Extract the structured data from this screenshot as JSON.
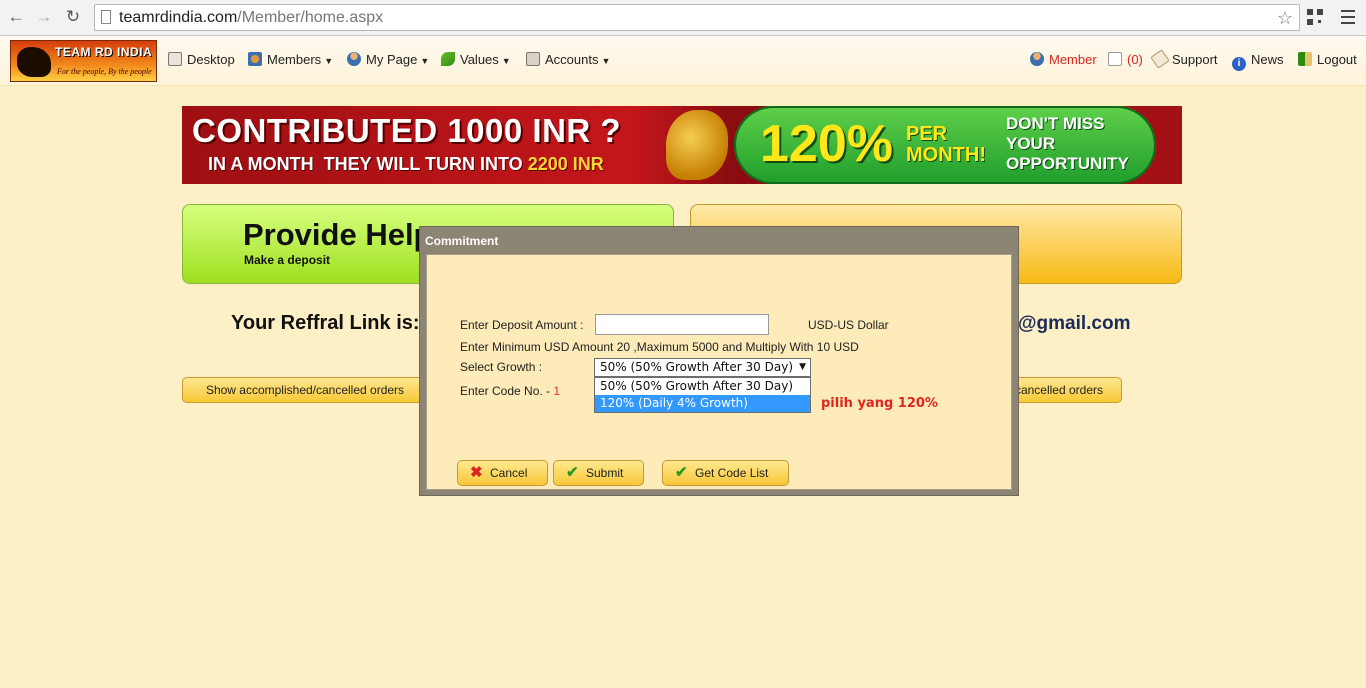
{
  "browser": {
    "url_host": "teamrdindia.com",
    "url_path": "/Member/home.aspx"
  },
  "header": {
    "logo_title": "TEAM RD INDIA",
    "logo_tagline": "For the people, By the people",
    "nav": [
      {
        "label": "Desktop",
        "icon": "desktop-icon"
      },
      {
        "label": "Members",
        "icon": "members-icon"
      },
      {
        "label": "My Page",
        "icon": "user-icon"
      },
      {
        "label": "Values",
        "icon": "butterfly-icon"
      },
      {
        "label": "Accounts",
        "icon": "accounts-icon"
      }
    ],
    "right": [
      {
        "label": "Member",
        "icon": "member-icon",
        "color": "#d9261c"
      },
      {
        "label": "(0)",
        "icon": "mail-icon",
        "color": "#d9261c"
      },
      {
        "label": "Support",
        "icon": "tag-icon"
      },
      {
        "label": "News",
        "icon": "info-icon"
      },
      {
        "label": "Logout",
        "icon": "logout-icon"
      }
    ]
  },
  "banner": {
    "headline": "CONTRIBUTED 1000 INR ?",
    "sub_white1": "IN A MONTH",
    "sub_white2": "THEY WILL TURN INTO",
    "sub_yellow": "2200 INR",
    "percent": "120%",
    "per_month": "PER MONTH!",
    "cta": "DON'T MISS YOUR OPPORTUNITY"
  },
  "cards": {
    "provide_title": "Provide Help",
    "provide_sub": "Make a deposit"
  },
  "referral": {
    "label": "Your Reffral Link is:",
    "email_tail": "@gmail.com"
  },
  "orders": {
    "left_button": "Show accomplished/cancelled orders",
    "right_button": "cancelled orders"
  },
  "modal": {
    "title": "Commitment",
    "deposit_label": "Enter Deposit Amount :",
    "deposit_value": "",
    "currency": "USD-US Dollar",
    "rule": "Enter Minimum USD Amount 20 ,Maximum 5000 and Multiply With 10 USD",
    "growth_label": "Select Growth :",
    "growth_selected": "50% (50% Growth After 30 Day)",
    "growth_options": [
      "50% (50% Growth After 30 Day)",
      "120% (Daily 4% Growth)"
    ],
    "code_label": "Enter Code No. -",
    "code_value": "1",
    "annotation": "pilih yang 120%",
    "cancel": "Cancel",
    "submit": "Submit",
    "code_list": "Get Code List"
  }
}
